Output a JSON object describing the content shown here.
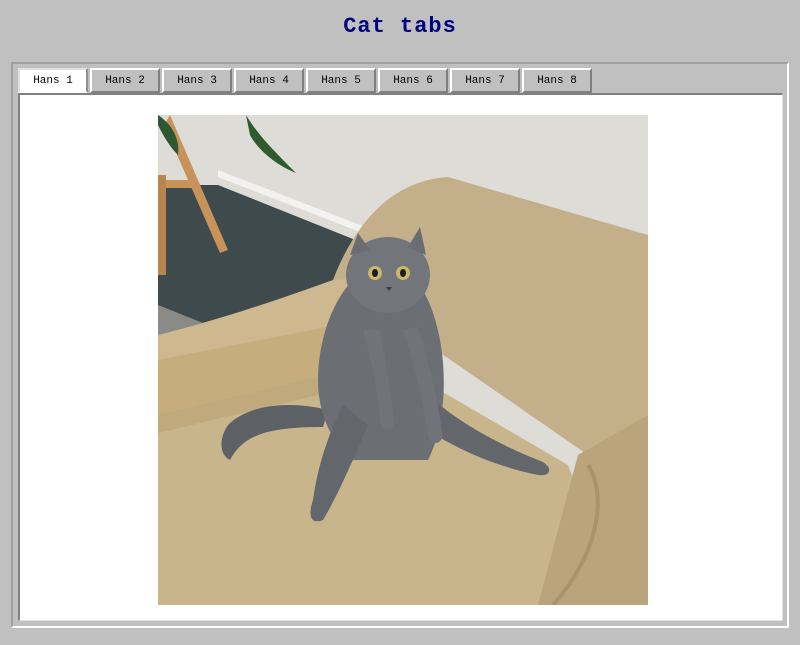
{
  "page": {
    "title": "Cat tabs"
  },
  "tabs": [
    {
      "label": "Hans 1",
      "active": true
    },
    {
      "label": "Hans 2",
      "active": false
    },
    {
      "label": "Hans 3",
      "active": false
    },
    {
      "label": "Hans 4",
      "active": false
    },
    {
      "label": "Hans 5",
      "active": false
    },
    {
      "label": "Hans 6",
      "active": false
    },
    {
      "label": "Hans 7",
      "active": false
    },
    {
      "label": "Hans 8",
      "active": false
    }
  ],
  "panel": {
    "image": "photo of a grey cat sitting upright on a beige armchair"
  },
  "colors": {
    "title": "#000080",
    "background": "#c0c0c0",
    "panel": "#ffffff"
  }
}
